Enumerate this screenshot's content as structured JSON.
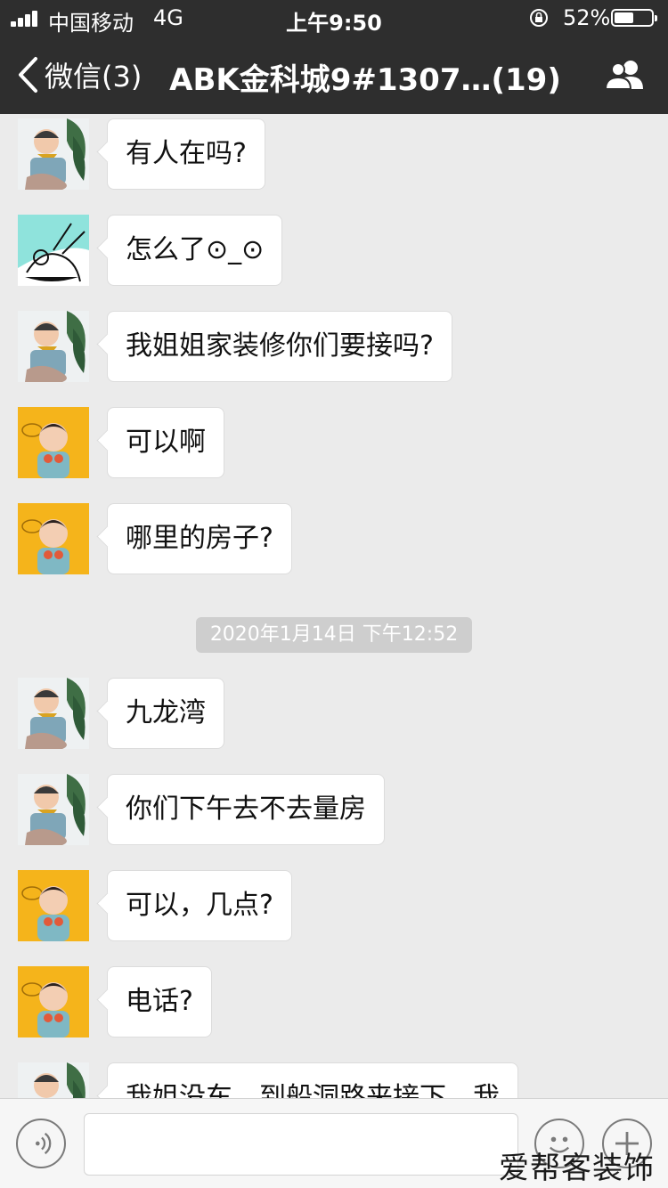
{
  "status_bar": {
    "carrier": "中国移动",
    "network": "4G",
    "time": "上午9:50",
    "battery_percent": "52%",
    "battery_level": 0.52
  },
  "nav": {
    "back_label": "微信(3)",
    "title": "ABK金科城9#1307…(19)",
    "members_icon": "group-members-icon"
  },
  "messages": [
    {
      "avatar": "boy-with-scarf",
      "text": "有人在吗?"
    },
    {
      "avatar": "sketch-drawing",
      "text": "怎么了⊙_⊙"
    },
    {
      "avatar": "boy-with-scarf",
      "text": "我姐姐家装修你们要接吗?"
    },
    {
      "avatar": "toddler-yellow",
      "text": "可以啊"
    },
    {
      "avatar": "toddler-yellow",
      "text": "哪里的房子?"
    },
    {
      "avatar": "boy-with-scarf",
      "text": "九龙湾"
    },
    {
      "avatar": "boy-with-scarf",
      "text": "你们下午去不去量房"
    },
    {
      "avatar": "toddler-yellow",
      "text": "可以，几点?"
    },
    {
      "avatar": "toddler-yellow",
      "text": "电话?"
    },
    {
      "avatar": "boy-with-scarf",
      "text": "我姐没车，到船洞路来接下，我"
    }
  ],
  "timestamp": "2020年1月14日 下午12:52",
  "input_bar": {
    "voice_icon": "voice-icon",
    "emoji_icon": "emoji-icon",
    "plus_icon": "plus-icon"
  },
  "watermark": "爱帮客装饰",
  "colors": {
    "nav_bg": "#2e2e2e",
    "chat_bg": "#ebebeb",
    "bubble_bg": "#ffffff",
    "timestamp_bg": "#cecece"
  }
}
